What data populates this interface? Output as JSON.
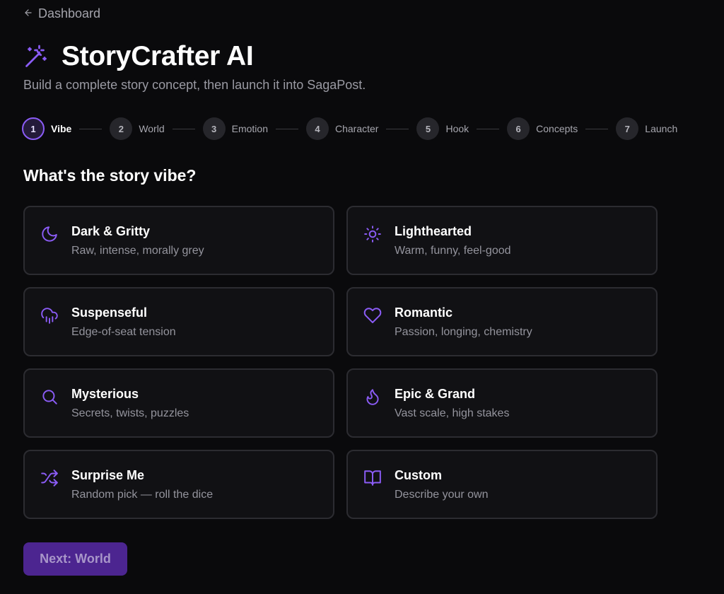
{
  "nav": {
    "back_label": "Dashboard",
    "back_icon": "arrow-left-icon"
  },
  "header": {
    "title": "StoryCrafter AI",
    "subtitle": "Build a complete story concept, then launch it into SagaPost.",
    "title_icon": "magic-wand-icon"
  },
  "stepper": {
    "active_index": 0,
    "steps": [
      {
        "number": "1",
        "label": "Vibe"
      },
      {
        "number": "2",
        "label": "World"
      },
      {
        "number": "3",
        "label": "Emotion"
      },
      {
        "number": "4",
        "label": "Character"
      },
      {
        "number": "5",
        "label": "Hook"
      },
      {
        "number": "6",
        "label": "Concepts"
      },
      {
        "number": "7",
        "label": "Launch"
      }
    ]
  },
  "main": {
    "question": "What's the story vibe?",
    "options": [
      {
        "title": "Dark & Gritty",
        "desc": "Raw, intense, morally grey",
        "icon": "moon-icon"
      },
      {
        "title": "Lighthearted",
        "desc": "Warm, funny, feel-good",
        "icon": "sun-icon"
      },
      {
        "title": "Suspenseful",
        "desc": "Edge-of-seat tension",
        "icon": "cloud-rain-icon"
      },
      {
        "title": "Romantic",
        "desc": "Passion, longing, chemistry",
        "icon": "heart-icon"
      },
      {
        "title": "Mysterious",
        "desc": "Secrets, twists, puzzles",
        "icon": "search-icon"
      },
      {
        "title": "Epic & Grand",
        "desc": "Vast scale, high stakes",
        "icon": "flame-icon"
      },
      {
        "title": "Surprise Me",
        "desc": "Random pick — roll the dice",
        "icon": "shuffle-icon"
      },
      {
        "title": "Custom",
        "desc": "Describe your own",
        "icon": "book-open-icon"
      }
    ]
  },
  "footer": {
    "next_label": "Next: World"
  },
  "colors": {
    "accent": "#8b5cf6",
    "background": "#0a0a0c",
    "card_bg": "#111114",
    "card_border": "#2c2c31",
    "button_bg": "#4c2590"
  }
}
